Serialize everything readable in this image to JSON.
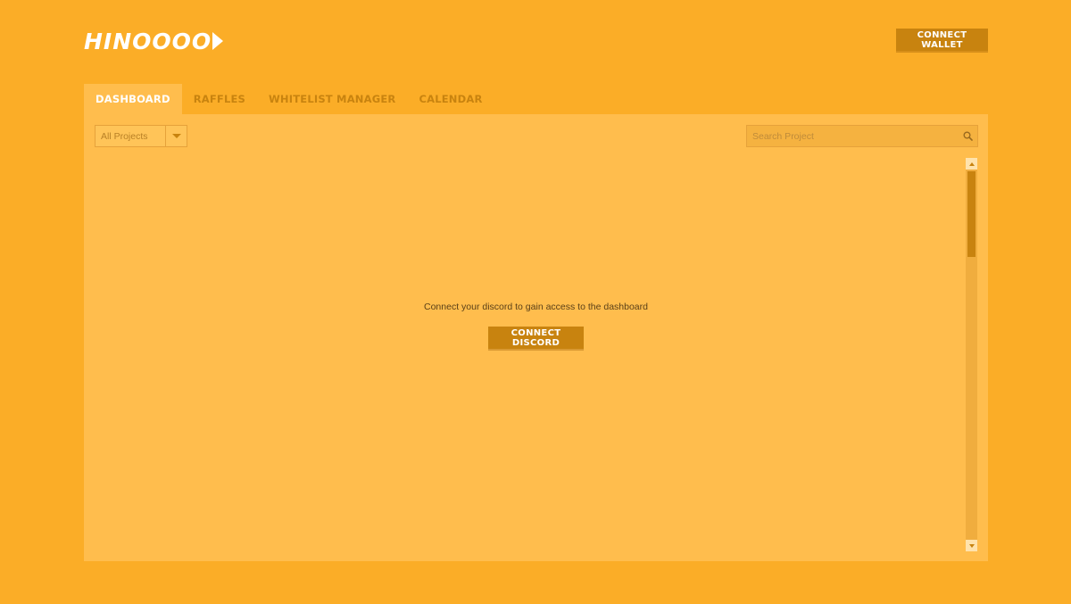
{
  "header": {
    "logo_text": "HINOOOO",
    "connect_wallet_label": "CONNECT WALLET"
  },
  "tabs": [
    {
      "label": "DASHBOARD",
      "active": true
    },
    {
      "label": "RAFFLES",
      "active": false
    },
    {
      "label": "WHITELIST MANAGER",
      "active": false
    },
    {
      "label": "CALENDAR",
      "active": false
    }
  ],
  "filters": {
    "project_select": {
      "selected": "All Projects"
    },
    "search": {
      "placeholder": "Search Project",
      "value": ""
    }
  },
  "main": {
    "message": "Connect your discord to gain access to the dashboard",
    "connect_discord_label": "CONNECT DISCORD"
  },
  "colors": {
    "background": "#fbad27",
    "panel": "#ffbd4d",
    "accent": "#c8830f",
    "text_on_accent": "#ffffff"
  },
  "icons": {
    "search": "search-icon",
    "dropdown": "chevron-down-icon",
    "logo_arrow": "play-arrow-icon"
  }
}
